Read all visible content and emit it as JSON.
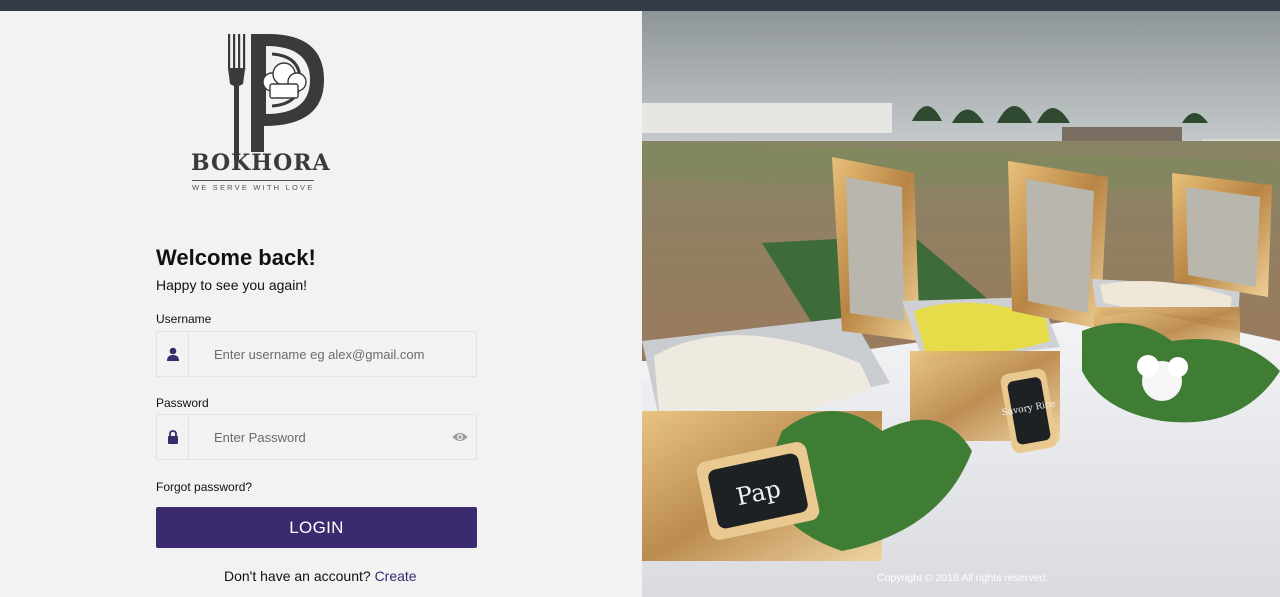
{
  "brand": {
    "name": "BOKHORA",
    "tagline": "WE SERVE WITH LOVE",
    "primary_color": "#3b2b6e",
    "topbar_color": "#333a48"
  },
  "login": {
    "title": "Welcome back!",
    "subtitle": "Happy to see you again!",
    "username_label": "Username",
    "username_placeholder": "Enter username eg alex@gmail.com",
    "username_icon": "user-icon",
    "password_label": "Password",
    "password_placeholder": "Enter Password",
    "password_icon": "lock-icon",
    "reveal_icon": "eye-icon",
    "forgot_label": "Forgot password?",
    "submit_label": "LOGIN",
    "signup_prompt": "Don't have an account?",
    "signup_link": "Create"
  },
  "hero": {
    "image": "catering buffet with chafing dishes outdoors",
    "sign_labels": [
      "Pap",
      "Savory Rice"
    ]
  },
  "footer": {
    "copyright": "Copyright © 2018 All rights reserved."
  }
}
